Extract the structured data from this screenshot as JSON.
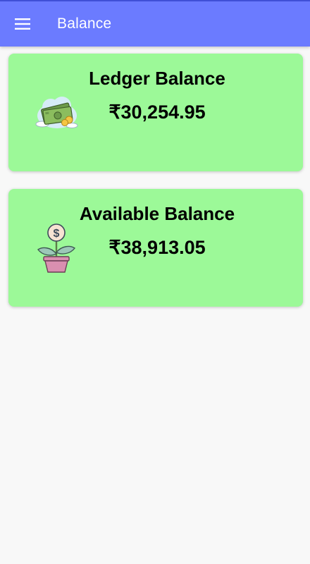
{
  "appbar": {
    "title": "Balance",
    "menu_icon": "hamburger-menu-icon",
    "color": "#6b7bff"
  },
  "cards": [
    {
      "title": "Ledger Balance",
      "amount": "₹30,254.95",
      "icon": "money-cash-icon",
      "color": "#9cf998"
    },
    {
      "title": "Available Balance",
      "amount": "₹38,913.05",
      "icon": "money-plant-icon",
      "color": "#9cf998"
    }
  ]
}
